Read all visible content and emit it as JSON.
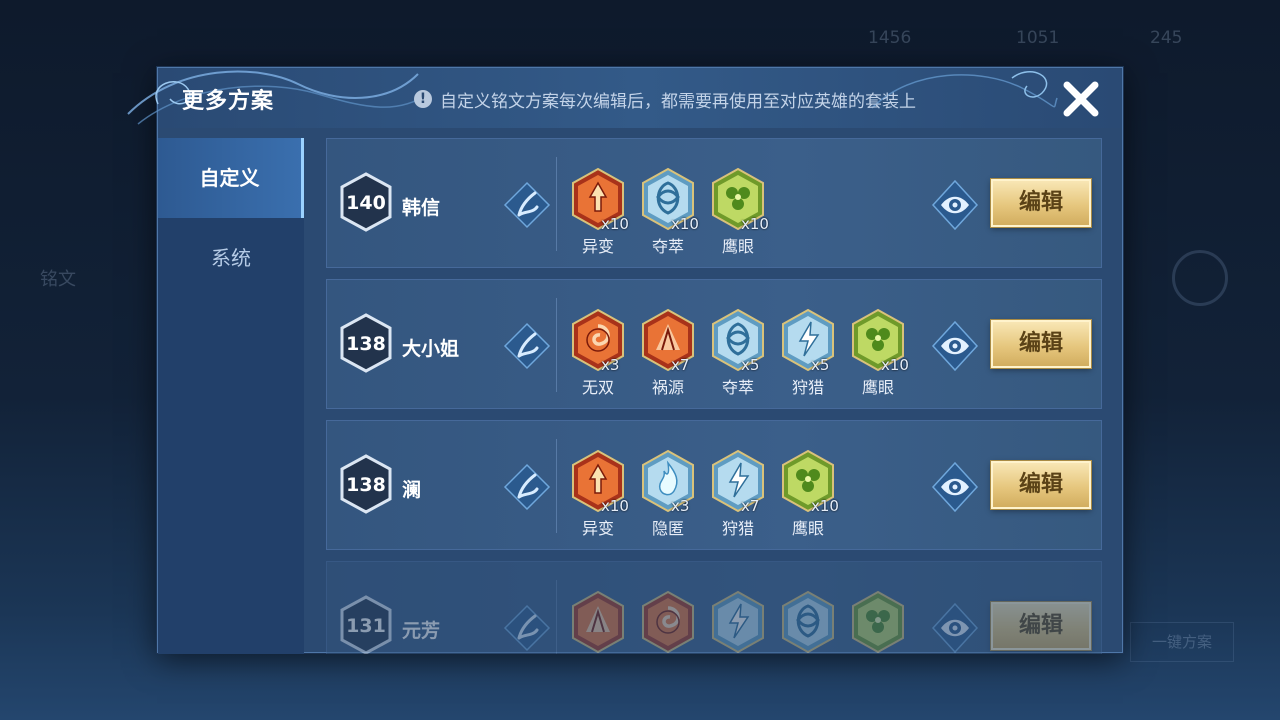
{
  "modal": {
    "title": "更多方案",
    "notice": "自定义铭文方案每次编辑后，都需要再使用至对应英雄的套装上",
    "notice_icon": "!"
  },
  "tabs": [
    {
      "label": "自定义",
      "active": true
    },
    {
      "label": "系统",
      "active": false
    }
  ],
  "edit_label": "编辑",
  "rows": [
    {
      "level": "140",
      "name": "韩信",
      "runes": [
        {
          "name": "异变",
          "count": "x10",
          "color": "red",
          "glyph": "sword"
        },
        {
          "name": "夺萃",
          "count": "x10",
          "color": "blue",
          "glyph": "knot"
        },
        {
          "name": "鹰眼",
          "count": "x10",
          "color": "green",
          "glyph": "clover"
        }
      ]
    },
    {
      "level": "138",
      "name": "大小姐",
      "runes": [
        {
          "name": "无双",
          "count": "x3",
          "color": "red",
          "glyph": "swirl"
        },
        {
          "name": "祸源",
          "count": "x7",
          "color": "red",
          "glyph": "fan"
        },
        {
          "name": "夺萃",
          "count": "x5",
          "color": "blue",
          "glyph": "knot"
        },
        {
          "name": "狩猎",
          "count": "x5",
          "color": "blue",
          "glyph": "bolt"
        },
        {
          "name": "鹰眼",
          "count": "x10",
          "color": "green",
          "glyph": "clover"
        }
      ]
    },
    {
      "level": "138",
      "name": "澜",
      "runes": [
        {
          "name": "异变",
          "count": "x10",
          "color": "red",
          "glyph": "sword"
        },
        {
          "name": "隐匿",
          "count": "x3",
          "color": "blue",
          "glyph": "flame"
        },
        {
          "name": "狩猎",
          "count": "x7",
          "color": "blue",
          "glyph": "bolt"
        },
        {
          "name": "鹰眼",
          "count": "x10",
          "color": "green",
          "glyph": "clover"
        }
      ]
    },
    {
      "level": "131",
      "name": "元芳",
      "runes": [
        {
          "name": "",
          "count": "",
          "color": "red",
          "glyph": "fan"
        },
        {
          "name": "",
          "count": "",
          "color": "red",
          "glyph": "swirl"
        },
        {
          "name": "",
          "count": "",
          "color": "blue",
          "glyph": "bolt"
        },
        {
          "name": "",
          "count": "",
          "color": "blue",
          "glyph": "knot"
        },
        {
          "name": "",
          "count": "",
          "color": "green",
          "glyph": "clover"
        }
      ]
    }
  ],
  "colors": {
    "red_light": "#f07a3a",
    "red_dark": "#a8321a",
    "blue_light": "#bfe2f4",
    "blue_dark": "#5f9cc2",
    "green_light": "#c6e06a",
    "green_dark": "#6f9a2a",
    "gold": "#e6c77e"
  },
  "background": {
    "topbar": [
      "1456",
      "1051",
      "245"
    ],
    "side": [
      "铭文"
    ],
    "bottom_button": "一键方案"
  }
}
